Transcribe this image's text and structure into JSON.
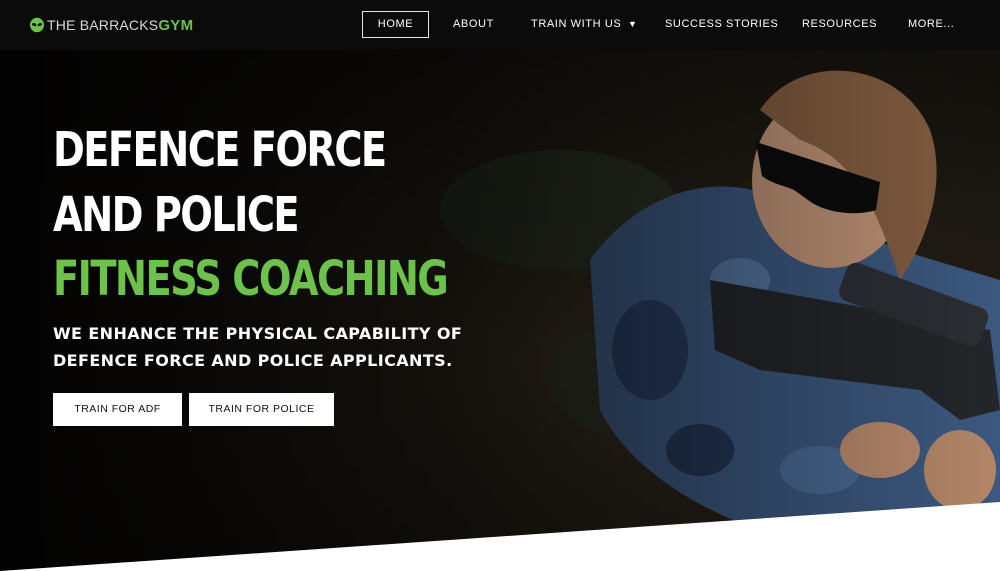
{
  "header": {
    "logo": {
      "icon": "alien-head-icon",
      "text_main": "THE BARRACKS",
      "text_accent": "GYM"
    },
    "nav": [
      {
        "label": "HOME",
        "active": true
      },
      {
        "label": "ABOUT"
      },
      {
        "label": "TRAIN WITH US",
        "caret": "▼"
      },
      {
        "label": "SUCCESS STORIES"
      },
      {
        "label": "RESOURCES"
      },
      {
        "label": "MORE..."
      }
    ]
  },
  "hero": {
    "headline_line1": "DEFENCE FORCE",
    "headline_line2": "AND POLICE",
    "headline_line3": "FITNESS COACHING",
    "subheadline": "WE ENHANCE THE PHYSICAL CAPABILITY OF DEFENCE FORCE AND POLICE APPLICANTS.",
    "buttons": [
      {
        "label": "TRAIN FOR ADF"
      },
      {
        "label": "TRAIN FOR POLICE"
      }
    ]
  },
  "colors": {
    "accent_green": "#6cc24a",
    "header_bg": "#0b0b0b",
    "text_light": "#ffffff"
  }
}
